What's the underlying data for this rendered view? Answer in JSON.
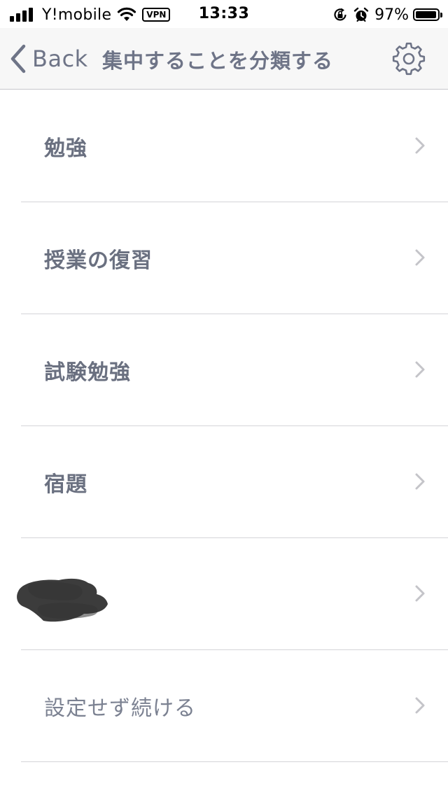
{
  "status_bar": {
    "carrier": "Y!mobile",
    "vpn_label": "VPN",
    "time": "13:33",
    "battery_percent": "97%",
    "battery_level": 0.97,
    "icons": [
      "signal-icon",
      "wifi-icon",
      "orientation-lock-icon",
      "alarm-icon",
      "battery-icon"
    ]
  },
  "nav": {
    "back_label": "Back",
    "title": "集中することを分類する",
    "settings_icon": "gear-icon"
  },
  "list": {
    "items": [
      {
        "label": "勉強",
        "redacted": false
      },
      {
        "label": "授業の復習",
        "redacted": false
      },
      {
        "label": "試験勉強",
        "redacted": false
      },
      {
        "label": "宿題",
        "redacted": false
      },
      {
        "label": "",
        "redacted": true
      },
      {
        "label": "設定せず続ける",
        "redacted": false
      }
    ]
  },
  "colors": {
    "text": "#6a7080",
    "nav_background": "#f7f7f7",
    "separator": "#d4d4d8",
    "chevron": "#c4c4c9"
  }
}
